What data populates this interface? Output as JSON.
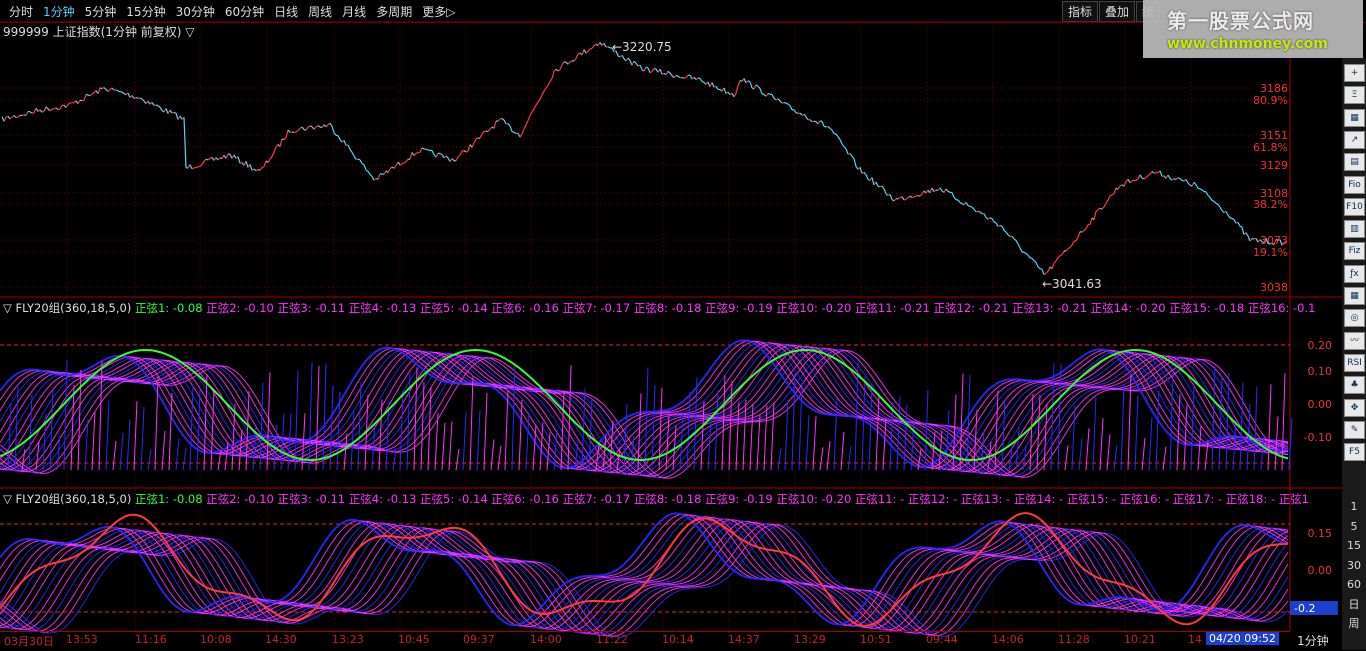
{
  "toolbar": {
    "periods": [
      "分时",
      "1分钟",
      "5分钟",
      "15分钟",
      "30分钟",
      "60分钟",
      "日线",
      "周线",
      "月线",
      "多周期",
      "更多▷"
    ],
    "active_period": "1分钟",
    "right_buttons": [
      "指标",
      "叠加",
      "统"
    ]
  },
  "watermark": {
    "line1": "第一股票公式网",
    "line2": "www.chnmoney.com"
  },
  "main": {
    "title": "999999 上证指数(1分钟 前复权) ▽",
    "high_label": "3220.75",
    "low_label": "3041.63",
    "price_axis": [
      "3186",
      "80.9%",
      "3151",
      "61.8%",
      "3129",
      "3108",
      "38.2%",
      "3073",
      "19.1%",
      "3038"
    ]
  },
  "ind1": {
    "name": "▽ FLY20组(360,18,5,0)",
    "items": [
      {
        "l": "正弦1: -0.08",
        "c": "g"
      },
      {
        "l": "正弦2: -0.10",
        "c": "m"
      },
      {
        "l": "正弦3: -0.11",
        "c": "m"
      },
      {
        "l": "正弦4: -0.13",
        "c": "m"
      },
      {
        "l": "正弦5: -0.14",
        "c": "m"
      },
      {
        "l": "正弦6: -0.16",
        "c": "m"
      },
      {
        "l": "正弦7: -0.17",
        "c": "m"
      },
      {
        "l": "正弦8: -0.18",
        "c": "m"
      },
      {
        "l": "正弦9: -0.19",
        "c": "m"
      },
      {
        "l": "正弦10: -0.20",
        "c": "m"
      },
      {
        "l": "正弦11: -0.21",
        "c": "m"
      },
      {
        "l": "正弦12: -0.21",
        "c": "m"
      },
      {
        "l": "正弦13: -0.21",
        "c": "m"
      },
      {
        "l": "正弦14: -0.20",
        "c": "m"
      },
      {
        "l": "正弦15: -0.18",
        "c": "m"
      },
      {
        "l": "正弦16: -0.1",
        "c": "m"
      }
    ],
    "axis": [
      "0.20",
      "0.10",
      "0.00",
      "-0.10"
    ]
  },
  "ind2": {
    "name": "▽ FLY20组(360,18,5,0)",
    "items": [
      {
        "l": "正弦1: -0.08",
        "c": "g"
      },
      {
        "l": "正弦2: -0.10",
        "c": "m"
      },
      {
        "l": "正弦3: -0.11",
        "c": "m"
      },
      {
        "l": "正弦4: -0.13",
        "c": "m"
      },
      {
        "l": "正弦5: -0.14",
        "c": "m"
      },
      {
        "l": "正弦6: -0.16",
        "c": "m"
      },
      {
        "l": "正弦7: -0.17",
        "c": "m"
      },
      {
        "l": "正弦8: -0.18",
        "c": "m"
      },
      {
        "l": "正弦9: -0.19",
        "c": "m"
      },
      {
        "l": "正弦10: -0.20",
        "c": "m"
      },
      {
        "l": "正弦11: -",
        "c": "m"
      },
      {
        "l": "正弦12: -",
        "c": "m"
      },
      {
        "l": "正弦13: -",
        "c": "m"
      },
      {
        "l": "正弦14: -",
        "c": "m"
      },
      {
        "l": "正弦15: -",
        "c": "m"
      },
      {
        "l": "正弦16: -",
        "c": "m"
      },
      {
        "l": "正弦17: -",
        "c": "m"
      },
      {
        "l": "正弦18: -",
        "c": "m"
      },
      {
        "l": "正弦1",
        "c": "m"
      }
    ],
    "axis": [
      "0.15",
      "0.00",
      "-0.15"
    ],
    "cursor_value": "-0.2"
  },
  "dates": [
    "03月30日",
    "13:53",
    "11:16",
    "10:08",
    "14:30",
    "13:23",
    "10:45",
    "09:37",
    "14:00",
    "11:22",
    "10:14",
    "14:37",
    "13:29",
    "10:51",
    "09:44",
    "14:06",
    "11:28",
    "10:21",
    "14"
  ],
  "cursor_date": "04/20 09:52",
  "period_label": "1分钟",
  "right_tools": [
    "+",
    "Ξ",
    "▦",
    "↗",
    "▤",
    "Fio",
    "F10",
    "▥",
    "Fiz",
    "ƒx",
    "▦",
    "◎",
    "〰",
    "RSI",
    "♣",
    "✥",
    "✎",
    "F5",
    "1",
    "5",
    "15",
    "30",
    "60",
    "日",
    "周"
  ],
  "colors": {
    "bg": "#000000",
    "grid": "#7a0000",
    "up": "#ff3b3b",
    "down": "#4fd8ff",
    "blue": "#2a2aff",
    "magenta": "#ff33ff",
    "green": "#33ff33"
  }
}
